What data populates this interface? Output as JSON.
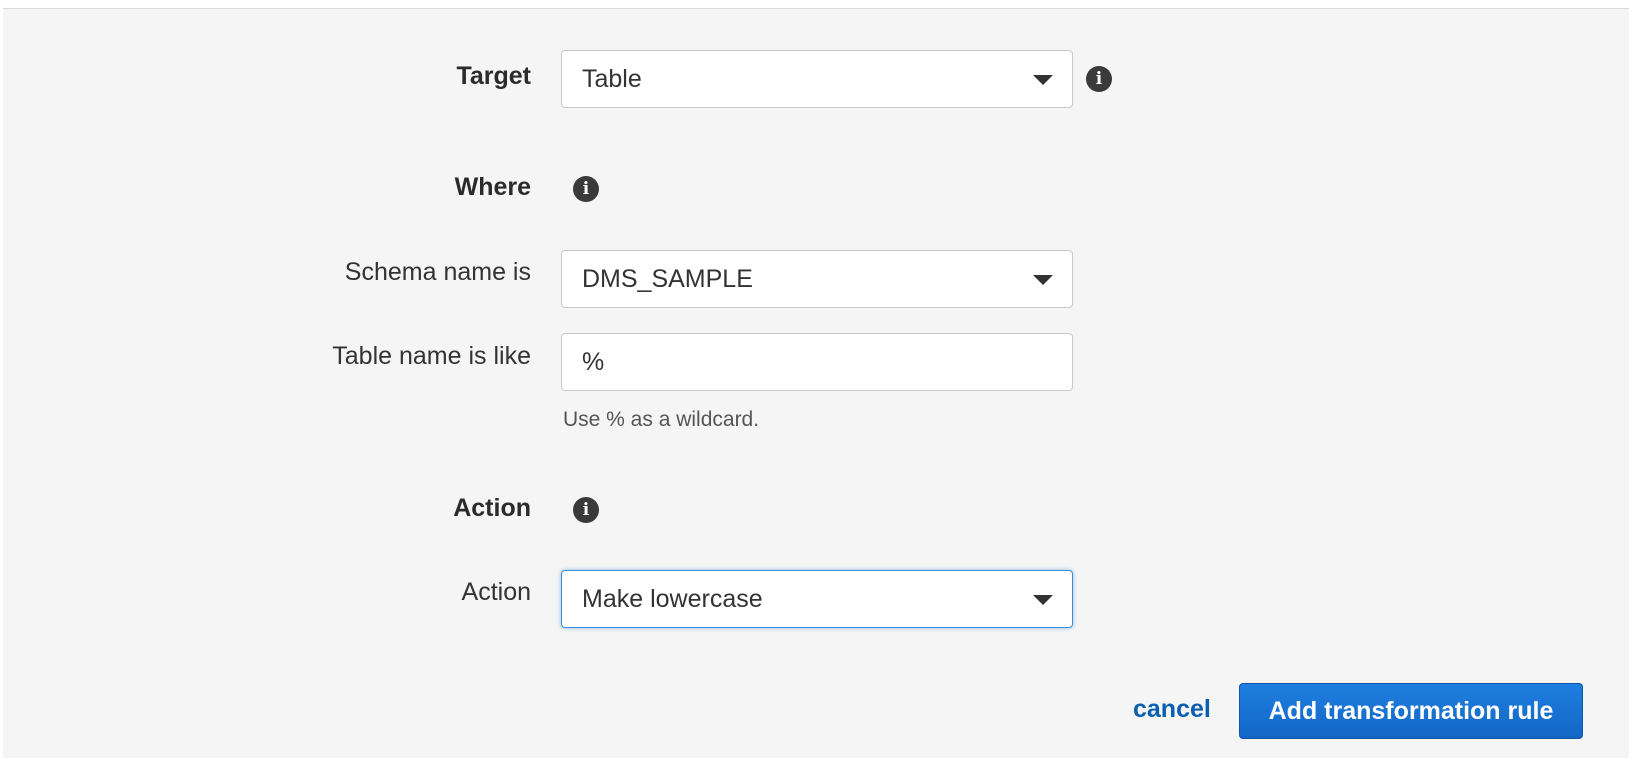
{
  "form": {
    "target": {
      "label": "Target",
      "value": "Table",
      "info_icon": "info-icon"
    },
    "where": {
      "heading": "Where",
      "info_icon": "info-icon"
    },
    "schema": {
      "label": "Schema name is",
      "value": "DMS_SAMPLE"
    },
    "table": {
      "label": "Table name is like",
      "value": "%",
      "help": "Use % as a wildcard."
    },
    "action_section": {
      "heading": "Action",
      "info_icon": "info-icon"
    },
    "action": {
      "label": "Action",
      "value": "Make lowercase"
    }
  },
  "buttons": {
    "cancel": "cancel",
    "submit": "Add transformation rule"
  },
  "colors": {
    "accent": "#1266c6",
    "link": "#0a5fb0",
    "focus": "#3d8fd9"
  }
}
